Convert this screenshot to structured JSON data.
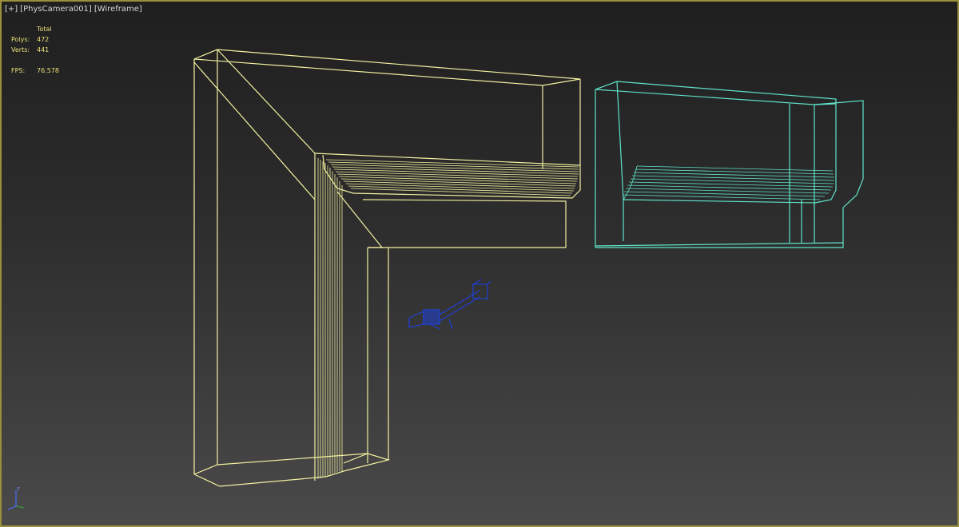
{
  "viewport": {
    "menu_label": "[+]",
    "camera_label": "[PhysCamera001]",
    "shading_label": "[Wireframe]"
  },
  "stats": {
    "header": "Total",
    "polys_label": "Polys:",
    "polys_value": "472",
    "verts_label": "Verts:",
    "verts_value": "441",
    "fps_label": "FPS:",
    "fps_value": "76.578"
  },
  "axis_gizmo": {
    "z_label": "z"
  },
  "colors": {
    "frame_border": "#9a8f3a",
    "selected_wire": "#f2f0a0",
    "object_wire": "#5fe3c9",
    "camera_wire": "#1f3fd6",
    "stats_text": "#e8e07a"
  },
  "icons": {
    "camera": "camera-icon",
    "axis": "axis-gizmo-icon"
  }
}
